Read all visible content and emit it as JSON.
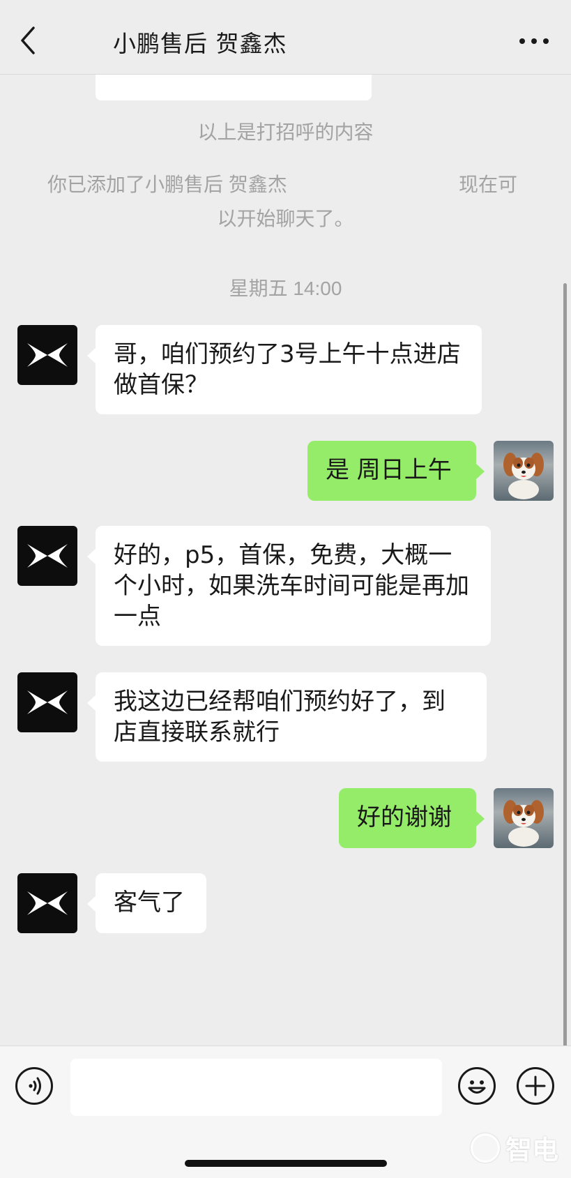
{
  "header": {
    "title": "小鹏售后 贺鑫杰",
    "back_icon": "chevron-left-icon",
    "more_icon": "more-dots-icon"
  },
  "system": {
    "greeting_note": "以上是打招呼的内容",
    "added_line1": "你已添加了小鹏售后 贺鑫杰",
    "added_line1_tail": "现在可",
    "added_line2": "以开始聊天了。",
    "timestamp": "星期五 14:00"
  },
  "messages": [
    {
      "side": "left",
      "text": "哥，咱们预约了3号上午十点进店做首保？"
    },
    {
      "side": "right",
      "text": "是 周日上午"
    },
    {
      "side": "left",
      "text": "好的，p5，首保，免费，大概一个小时，如果洗车时间可能是再加一点"
    },
    {
      "side": "left",
      "text": "我这边已经帮咱们预约好了，到店直接联系就行"
    },
    {
      "side": "right",
      "text": "好的谢谢"
    },
    {
      "side": "left",
      "text": "客气了"
    }
  ],
  "input": {
    "placeholder": "",
    "voice_icon": "voice-icon",
    "emoji_icon": "emoji-icon",
    "plus_icon": "plus-icon"
  },
  "watermark": {
    "text": "智电",
    "logo_icon": "pen-circle-icon"
  },
  "colors": {
    "background": "#ededed",
    "sent_bubble": "#95ec69",
    "received_bubble": "#ffffff",
    "system_text": "#a3a3a3"
  }
}
